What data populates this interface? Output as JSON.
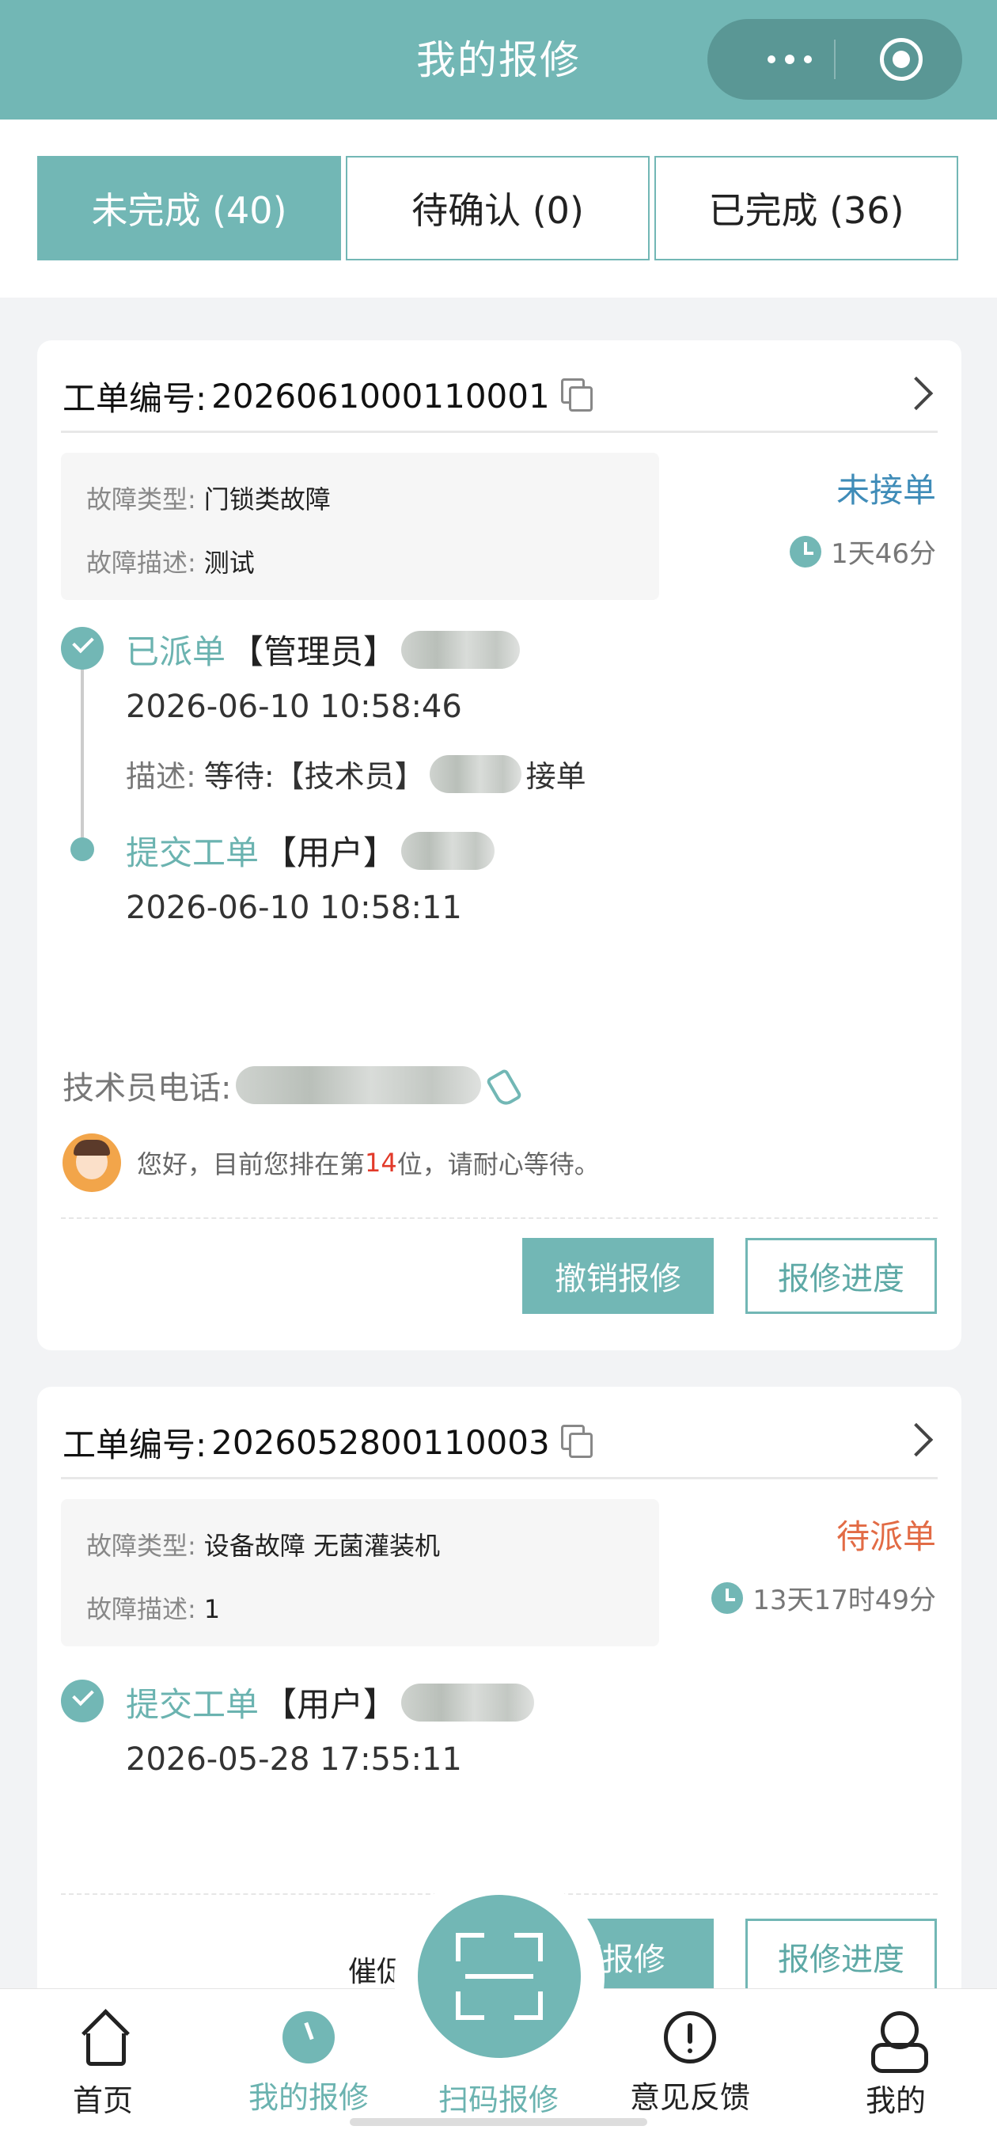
{
  "header": {
    "title": "我的报修"
  },
  "tabs": [
    {
      "label": "未完成 (40)"
    },
    {
      "label": "待确认 (0)"
    },
    {
      "label": "已完成 (36)"
    }
  ],
  "orders": [
    {
      "order_label": "工单编号:",
      "order_no": "2026061000110001",
      "fault_type_label": "故障类型:",
      "fault_type": "门锁类故障",
      "fault_desc_label": "故障描述:",
      "fault_desc": "测试",
      "status": "未接单",
      "elapsed": "1天46分",
      "timeline": [
        {
          "action": "已派单",
          "role": "【管理员】",
          "time": "2026-06-10 10:58:46",
          "desc_label": "描述:",
          "desc_pre": "等待:【技术员】",
          "desc_post": "接单"
        },
        {
          "action": "提交工单",
          "role": "【用户】",
          "time": "2026-06-10 10:58:11"
        }
      ],
      "tech_phone_label": "技术员电话:",
      "queue_pre": "您好，目前您排在第",
      "queue_num": "14",
      "queue_post": "位，请耐心等待。",
      "btn_cancel": "撤销报修",
      "btn_progress": "报修进度"
    },
    {
      "order_label": "工单编号:",
      "order_no": "2026052800110003",
      "fault_type_label": "故障类型:",
      "fault_type": "设备故障 无菌灌装机",
      "fault_desc_label": "故障描述:",
      "fault_desc": "1",
      "status": "待派单",
      "elapsed": "13天17时49分",
      "timeline": [
        {
          "action": "提交工单",
          "role": "【用户】",
          "time": "2026-05-28 17:55:11"
        }
      ],
      "btn_cancel_partial": "销报修",
      "btn_progress": "报修进度",
      "urge_label_partial": "催促"
    }
  ],
  "bottom_nav": {
    "home": "首页",
    "my_repairs": "我的报修",
    "scan": "扫码报修",
    "feedback": "意见反馈",
    "mine": "我的"
  },
  "colors": {
    "accent": "#72b7b5",
    "status_blue": "#3f8cb8",
    "status_orange": "#e26b45",
    "queue_red": "#e23a2a"
  }
}
